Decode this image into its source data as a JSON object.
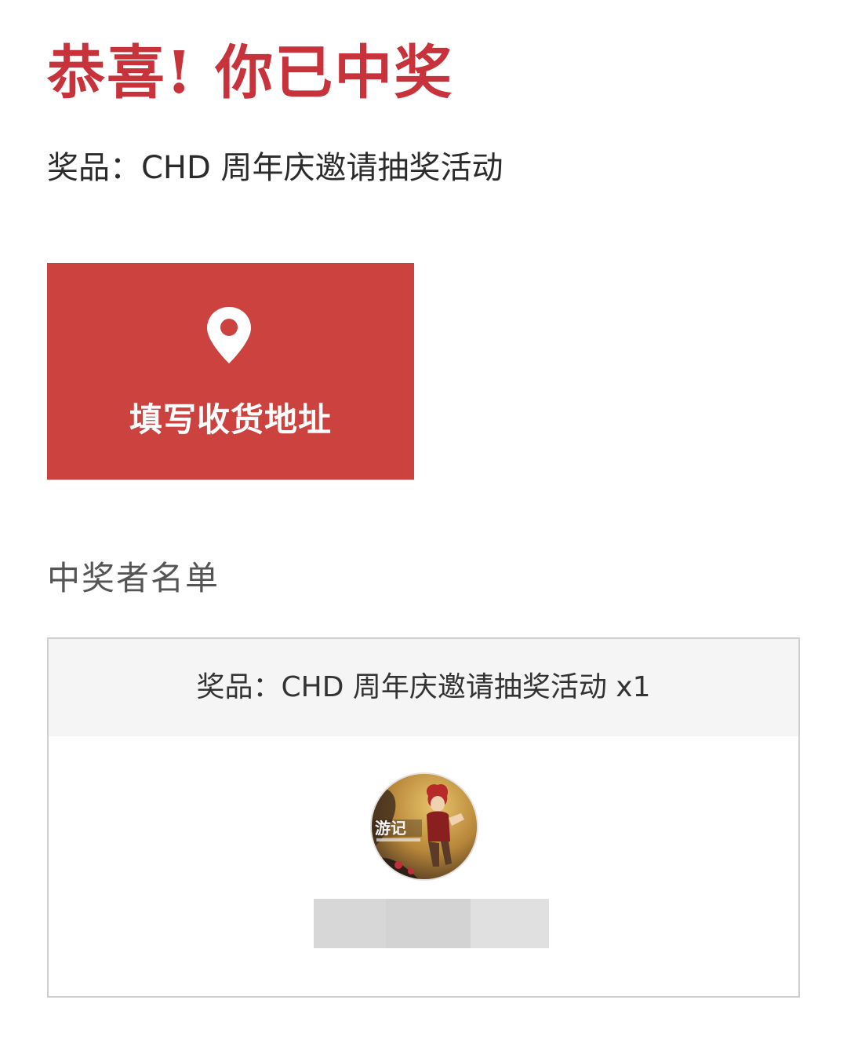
{
  "header": {
    "title": "恭喜! 你已中奖",
    "prize_line": "奖品：CHD 周年庆邀请抽奖活动"
  },
  "address_button": {
    "icon": "location-pin-icon",
    "label": "填写收货地址",
    "color": "#cb423f"
  },
  "winners": {
    "section_title": "中奖者名单",
    "header": "奖品：CHD 周年庆邀请抽奖活动 x1",
    "avatar_caption": "游记"
  },
  "colors": {
    "accent": "#c8323a",
    "button": "#cb423f"
  }
}
